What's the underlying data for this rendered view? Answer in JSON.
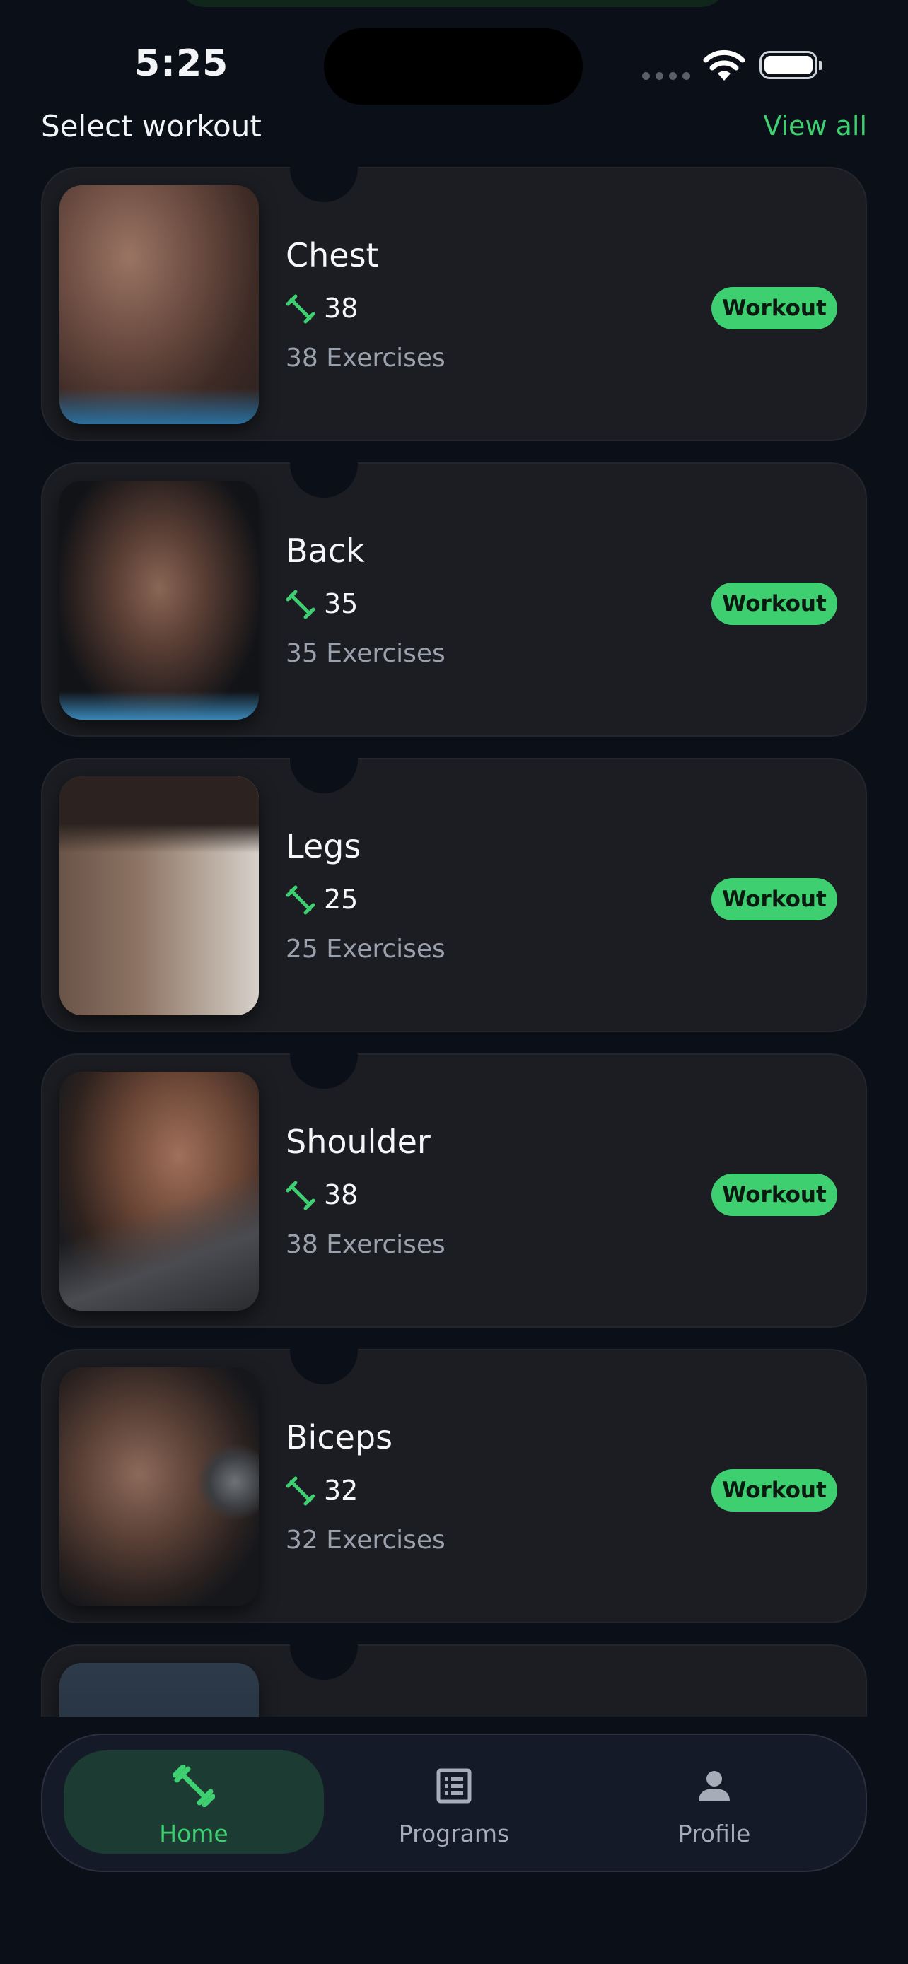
{
  "status_bar": {
    "time": "5:25"
  },
  "header": {
    "title": "Select workout",
    "view_all": "View all"
  },
  "workouts": [
    {
      "name": "Chest",
      "count": "38",
      "exercises": "38 Exercises",
      "button": "Workout",
      "image": "chest-muscles-photo"
    },
    {
      "name": "Back",
      "count": "35",
      "exercises": "35 Exercises",
      "button": "Workout",
      "image": "back-muscles-photo"
    },
    {
      "name": "Legs",
      "count": "25",
      "exercises": "25 Exercises",
      "button": "Workout",
      "image": "leg-muscles-photo"
    },
    {
      "name": "Shoulder",
      "count": "38",
      "exercises": "38 Exercises",
      "button": "Workout",
      "image": "shoulder-muscles-photo"
    },
    {
      "name": "Biceps",
      "count": "32",
      "exercises": "32 Exercises",
      "button": "Workout",
      "image": "biceps-muscles-photo"
    },
    {
      "name": "",
      "count": "",
      "exercises": "",
      "button": "",
      "image": "partially-visible-photo"
    }
  ],
  "nav": {
    "items": [
      {
        "label": "Home",
        "icon": "dumbbell-icon",
        "active": true
      },
      {
        "label": "Programs",
        "icon": "list-icon",
        "active": false
      },
      {
        "label": "Profile",
        "icon": "person-icon",
        "active": false
      }
    ]
  },
  "colors": {
    "background": "#0b0f18",
    "card": "#1b1d22",
    "accent": "#3ecf71",
    "muted_text": "#9aa1ad",
    "nav_bg": "#151a29",
    "nav_active_bg": "#1c3b33"
  }
}
